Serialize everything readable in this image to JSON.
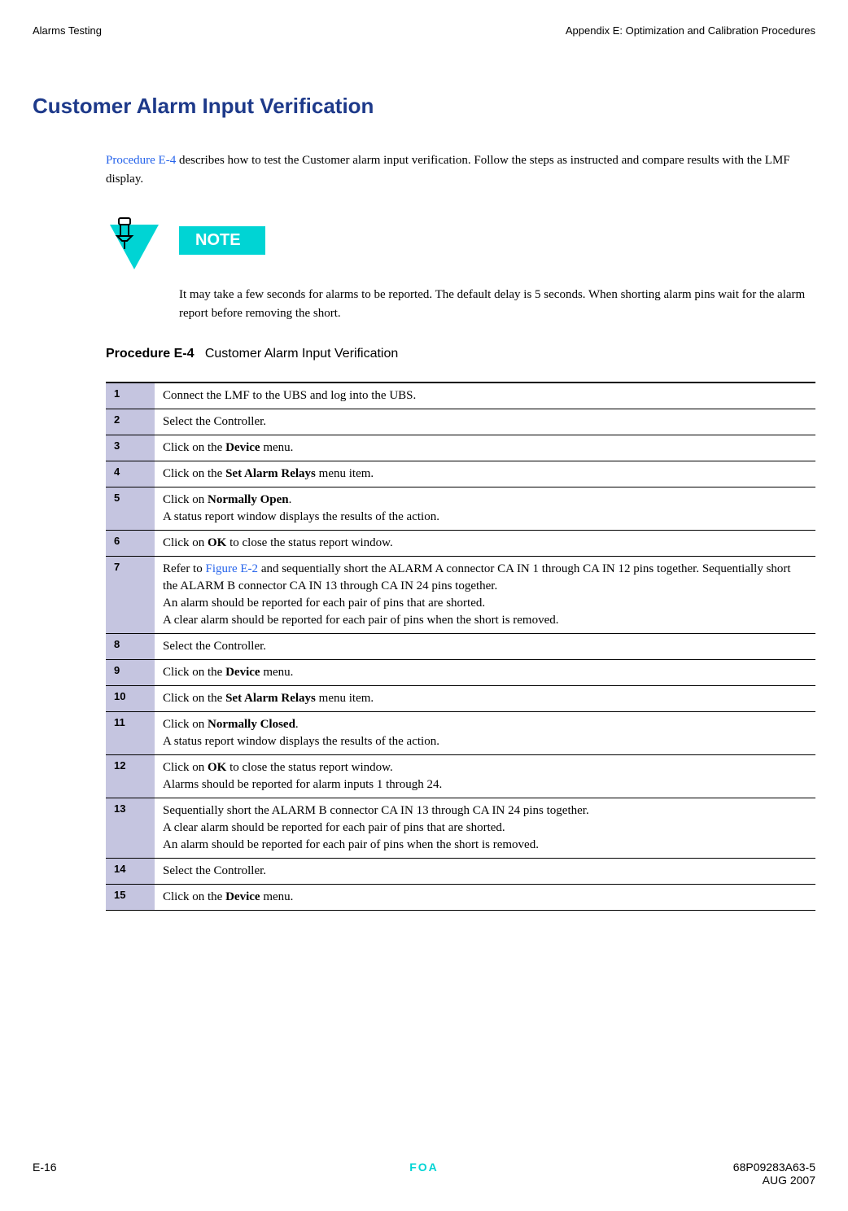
{
  "header": {
    "left": "Alarms Testing",
    "right": "Appendix E: Optimization and Calibration Procedures"
  },
  "title": "Customer Alarm Input Verification",
  "intro": {
    "link": "Procedure E-4",
    "text": " describes how to test the Customer alarm input verification. Follow the steps as instructed and compare results with the LMF display."
  },
  "note": {
    "label": "NOTE",
    "text": "It may take a few seconds for alarms to be reported. The default delay is 5 seconds. When shorting alarm pins wait for the alarm report before removing the short."
  },
  "procedure": {
    "label": "Procedure E-4",
    "title": "Customer Alarm Input Verification",
    "steps": [
      {
        "num": "1",
        "text": "Connect the LMF to the UBS and log into the UBS."
      },
      {
        "num": "2",
        "text": "Select the Controller."
      },
      {
        "num": "3",
        "pre": "Click on the ",
        "bold": "Device",
        "post": " menu."
      },
      {
        "num": "4",
        "pre": "Click on the ",
        "bold": "Set Alarm Relays",
        "post": " menu item."
      },
      {
        "num": "5",
        "pre": "Click on ",
        "bold": "Normally Open",
        "post": ".",
        "line2": "A status report window displays the results of the action."
      },
      {
        "num": "6",
        "pre": "Click on ",
        "bold": "OK",
        "post": " to close the status report window."
      },
      {
        "num": "7",
        "pre": "Refer to ",
        "link": "Figure E-2",
        "post": " and sequentially short the ALARM A connector CA IN 1 through CA IN 12 pins together. Sequentially short the ALARM B connector CA IN 13 through CA IN 24 pins together.",
        "line2": "An alarm should be reported for each pair of pins that are shorted.",
        "line3": "A clear alarm should be reported for each pair of pins when the short is removed."
      },
      {
        "num": "8",
        "text": "Select the Controller."
      },
      {
        "num": "9",
        "pre": "Click on the ",
        "bold": "Device",
        "post": " menu."
      },
      {
        "num": "10",
        "pre": "Click on the ",
        "bold": "Set Alarm Relays",
        "post": " menu item."
      },
      {
        "num": "11",
        "pre": "Click on ",
        "bold": "Normally Closed",
        "post": ".",
        "line2": "A status report window displays the results of the action."
      },
      {
        "num": "12",
        "pre": "Click on ",
        "bold": "OK",
        "post": " to close the status report window.",
        "line2": "Alarms should be reported for alarm inputs 1 through 24."
      },
      {
        "num": "13",
        "text": "Sequentially short the ALARM B connector CA IN 13 through CA IN 24 pins together.",
        "line2": "A clear alarm should be reported for each pair of pins that are shorted.",
        "line3": "An alarm should be reported for each pair of pins when the short is removed."
      },
      {
        "num": "14",
        "text": "Select the Controller."
      },
      {
        "num": "15",
        "pre": "Click on the ",
        "bold": "Device",
        "post": " menu."
      }
    ]
  },
  "footer": {
    "left": "E-16",
    "center": "FOA",
    "right_top": "68P09283A63-5",
    "right_bottom": "AUG 2007"
  }
}
